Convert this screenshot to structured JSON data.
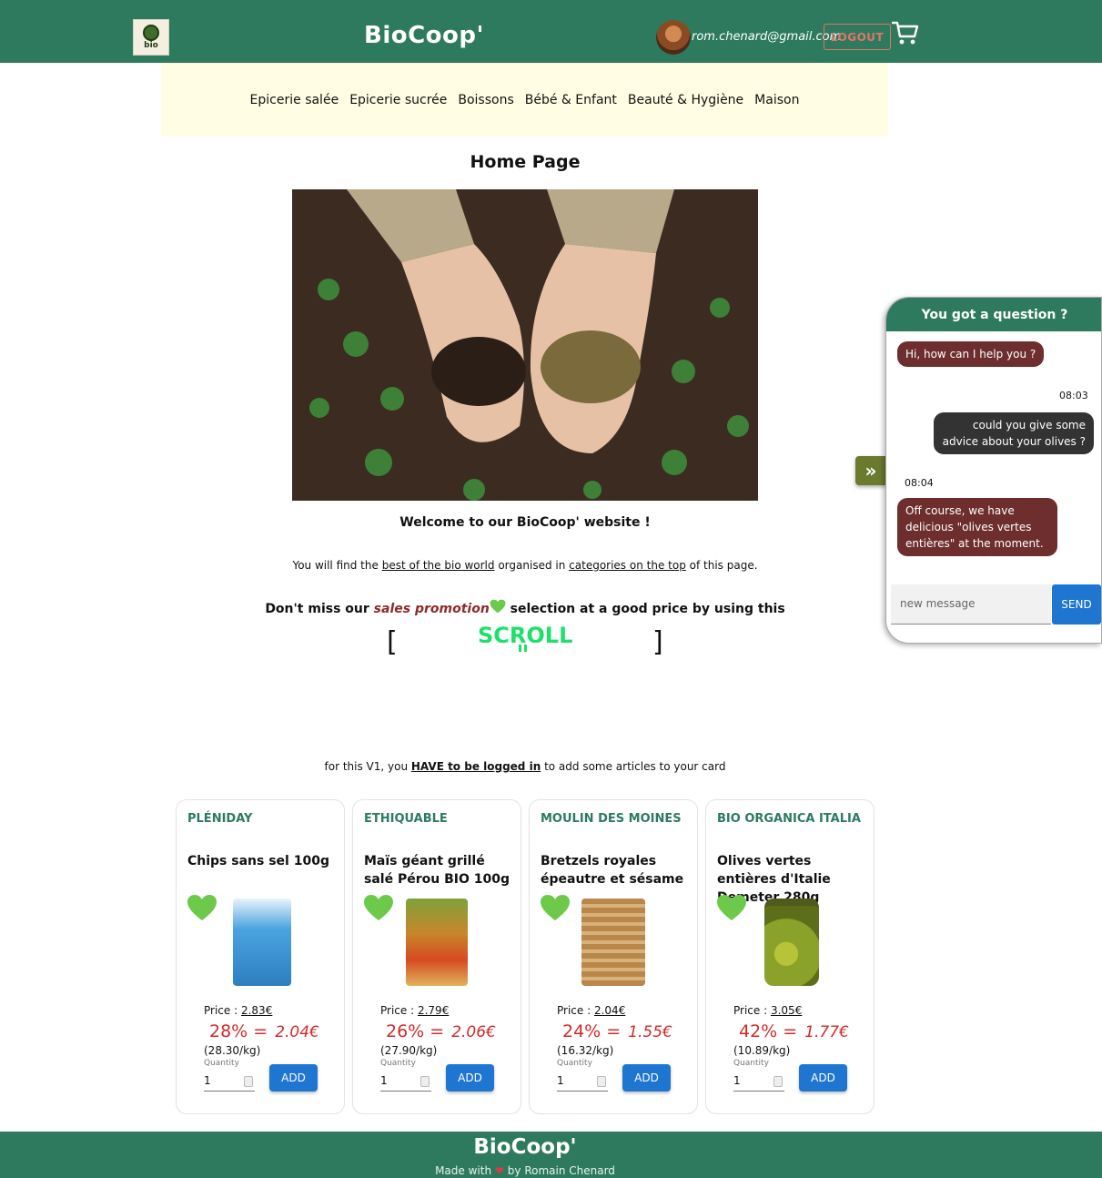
{
  "header": {
    "brand": "BioCoop'",
    "logo_text": "bio",
    "user_email": "rom.chenard@gmail.com",
    "logout_label": "LOGOUT",
    "cart_icon": "cart-icon"
  },
  "categories": [
    "Epicerie salée",
    "Epicerie sucrée",
    "Boissons",
    "Bébé & Enfant",
    "Beauté & Hygiène",
    "Maison"
  ],
  "main": {
    "title": "Home Page",
    "welcome": "Welcome to our BioCoop' website !",
    "find_prefix": "You will find the",
    "find_link1": "best of the bio world",
    "find_middle": "organised in",
    "find_link2": "categories on the top",
    "find_suffix": "of this page.",
    "promo_prefix": "Don't miss our",
    "promo_sales": "sales promotion",
    "promo_suffix": "selection at a good price by using this",
    "scroll_label": "SCROLL",
    "bracket_left": "[",
    "bracket_right": "]",
    "login_prefix": "for this V1, you",
    "login_link": "HAVE to be logged in",
    "login_suffix": "to add some articles to your card"
  },
  "products": [
    {
      "brand": "PLÉNIDAY",
      "name": "Chips sans sel 100g",
      "price_label": "Price :",
      "price": "2.83€",
      "discount": "28% =",
      "promo_price": "2.04€",
      "per_kg": "(28.30/kg)",
      "qty_label": "Quantity",
      "qty": "1",
      "add_label": "ADD",
      "pack_color": "#4aa3df"
    },
    {
      "brand": "ETHIQUABLE",
      "name": "Maïs géant grillé salé Pérou BIO 100g",
      "price_label": "Price :",
      "price": "2.79€",
      "discount": "26% =",
      "promo_price": "2.06€",
      "per_kg": "(27.90/kg)",
      "qty_label": "Quantity",
      "qty": "1",
      "add_label": "ADD",
      "pack_color": "#c8862a"
    },
    {
      "brand": "MOULIN DES MOINES",
      "name": "Bretzels royales épeautre et sésame",
      "price_label": "Price :",
      "price": "2.04€",
      "discount": "24% =",
      "promo_price": "1.55€",
      "per_kg": "(16.32/kg)",
      "qty_label": "Quantity",
      "qty": "1",
      "add_label": "ADD",
      "pack_color": "#b9874a"
    },
    {
      "brand": "BIO ORGANICA ITALIA",
      "name": "Olives vertes entières d'Italie Demeter 280g",
      "price_label": "Price :",
      "price": "3.05€",
      "discount": "42% =",
      "promo_price": "1.77€",
      "per_kg": "(10.89/kg)",
      "qty_label": "Quantity",
      "qty": "1",
      "add_label": "ADD",
      "pack_color": "#8aa22a"
    }
  ],
  "chat": {
    "title": "You got a question ?",
    "messages": [
      {
        "from": "bot",
        "text": "Hi, how can I help you ?"
      },
      {
        "from": "time",
        "text": "08:03"
      },
      {
        "from": "user",
        "text": "could you give some advice about your olives ?"
      },
      {
        "from": "time",
        "text": "08:04"
      },
      {
        "from": "bot",
        "text": "Off course, we have delicious \"olives vertes entières\" at the moment."
      }
    ],
    "input_placeholder": "new message",
    "send_label": "SEND",
    "toggle_icon": "double-chevron-right-icon"
  },
  "footer": {
    "brand": "BioCoop'",
    "made_prefix": "Made with",
    "made_suffix": "by Romain Chenard"
  },
  "colors": {
    "primary": "#2d7a5f",
    "category_bg": "#fffee4",
    "brand_text": "#2d7a5f",
    "promo_red": "#d12b2b",
    "button_blue": "#1e76d1",
    "heart_green": "#6cc94a",
    "chat_bot": "#6e2e2e",
    "chat_user": "#333333"
  }
}
